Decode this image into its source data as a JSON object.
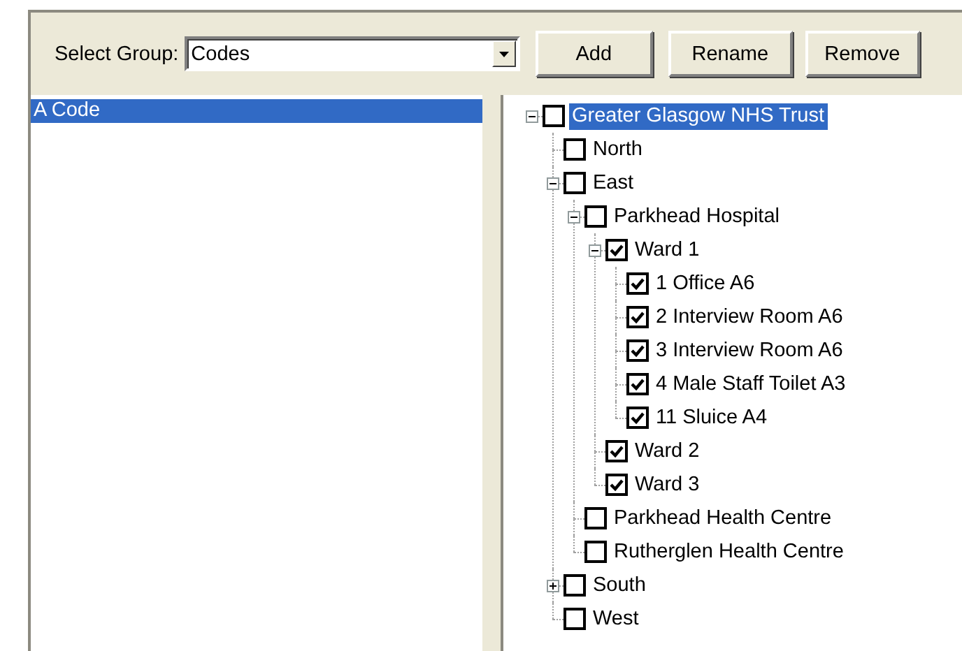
{
  "toolbar": {
    "label": "Select Group:",
    "group": {
      "value": "Codes"
    },
    "buttons": [
      "Add",
      "Rename",
      "Remove"
    ]
  },
  "list": {
    "items": [
      {
        "label": "A Code",
        "selected": true
      }
    ]
  },
  "tree": {
    "nodes": [
      {
        "label": "Greater Glasgow NHS Trust",
        "checked": false,
        "selected": true,
        "expanded": true,
        "children": [
          {
            "label": "North",
            "checked": false,
            "selected": false
          },
          {
            "label": "East",
            "checked": false,
            "selected": false,
            "expanded": true,
            "children": [
              {
                "label": "Parkhead Hospital",
                "checked": false,
                "selected": false,
                "expanded": true,
                "children": [
                  {
                    "label": "Ward 1",
                    "checked": true,
                    "selected": false,
                    "expanded": true,
                    "children": [
                      {
                        "label": "1 Office A6",
                        "checked": true,
                        "selected": false
                      },
                      {
                        "label": "2 Interview Room A6",
                        "checked": true,
                        "selected": false
                      },
                      {
                        "label": "3 Interview Room A6",
                        "checked": true,
                        "selected": false
                      },
                      {
                        "label": "4 Male Staff Toilet A3",
                        "checked": true,
                        "selected": false
                      },
                      {
                        "label": "11 Sluice A4",
                        "checked": true,
                        "selected": false
                      }
                    ]
                  },
                  {
                    "label": "Ward 2",
                    "checked": true,
                    "selected": false
                  },
                  {
                    "label": "Ward 3",
                    "checked": true,
                    "selected": false
                  }
                ]
              },
              {
                "label": "Parkhead Health Centre",
                "checked": false,
                "selected": false
              },
              {
                "label": "Rutherglen Health Centre",
                "checked": false,
                "selected": false
              }
            ]
          },
          {
            "label": "South",
            "checked": false,
            "selected": false,
            "expanded": false
          },
          {
            "label": "West",
            "checked": false,
            "selected": false
          }
        ]
      }
    ]
  }
}
